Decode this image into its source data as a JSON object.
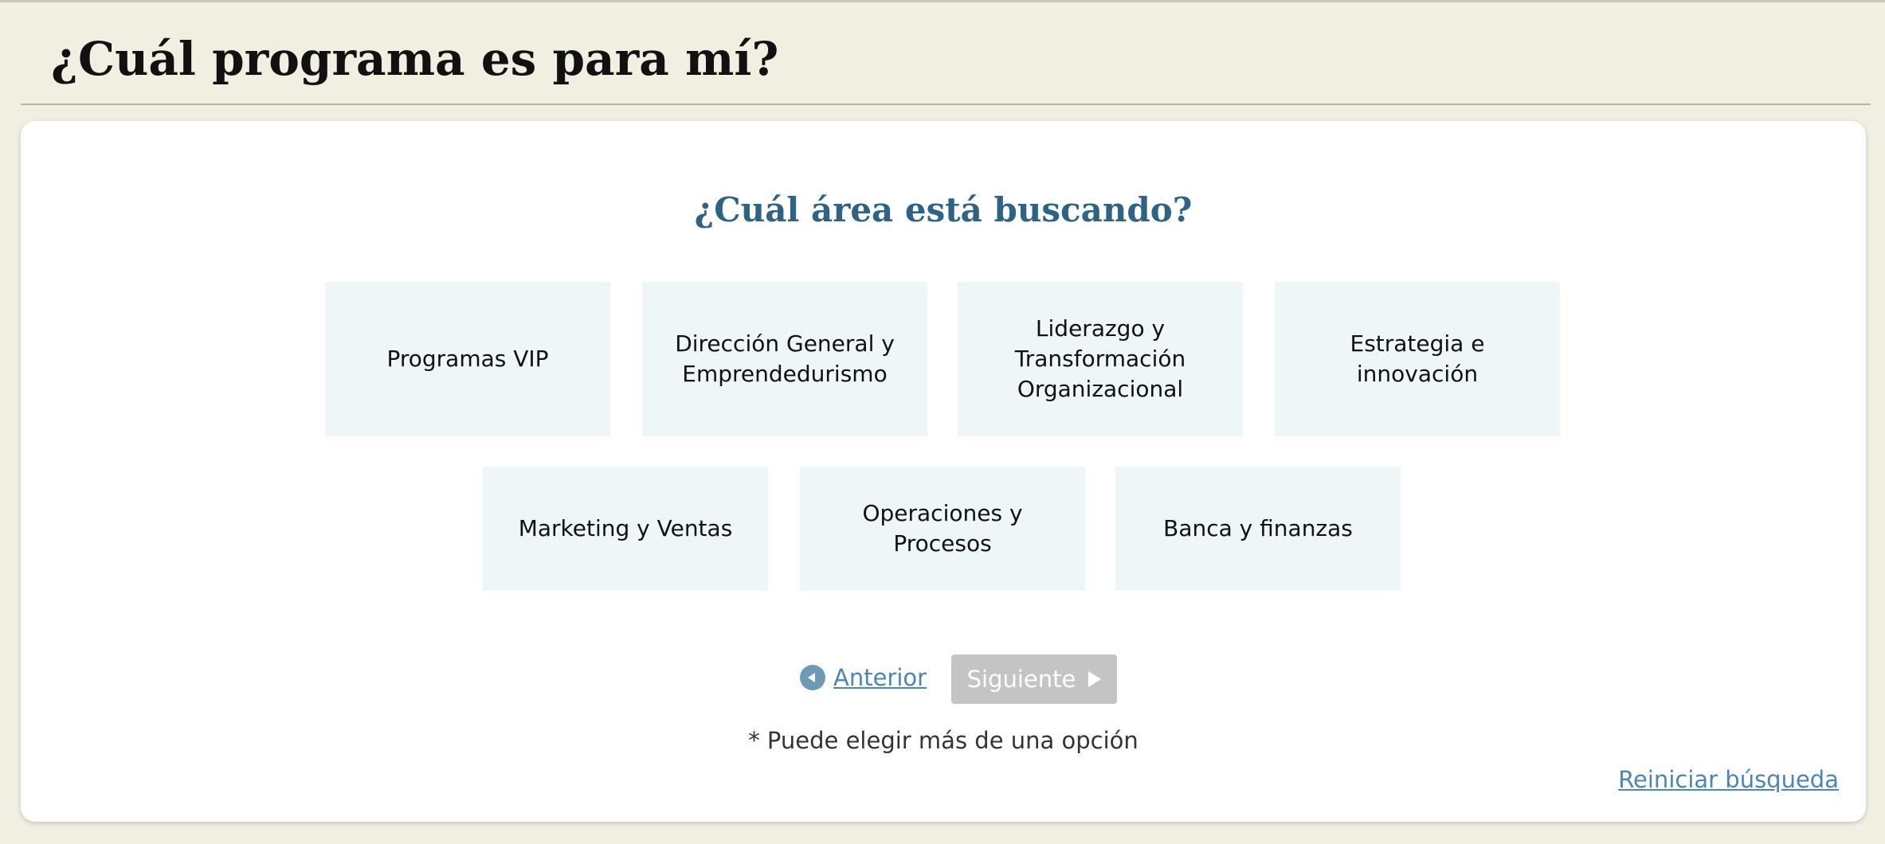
{
  "header": {
    "title": "¿Cuál programa es para mí?"
  },
  "main": {
    "question": "¿Cuál área está buscando?",
    "options": [
      {
        "label": "Programas VIP"
      },
      {
        "label": "Dirección General y\nEmprendedurismo"
      },
      {
        "label": "Liderazgo y\nTransformación\nOrganizacional"
      },
      {
        "label": "Estrategia e\ninnovación"
      },
      {
        "label": "Marketing y Ventas"
      },
      {
        "label": "Operaciones y\nProcesos"
      },
      {
        "label": "Banca y finanzas"
      }
    ],
    "navigation": {
      "previous_label": "Anterior",
      "next_label": "Siguiente",
      "previous_icon": "circle-arrow-left-icon",
      "next_icon": "triangle-right-icon"
    },
    "hint": "* Puede elegir más de una opción",
    "reset_label": "Reiniciar búsqueda"
  },
  "colors": {
    "page_background": "#f1eee2",
    "heading_blue": "#2e6383",
    "link_blue": "#4b86b4",
    "option_background": "#eef6f8",
    "disabled_button": "#c4c4c4"
  }
}
